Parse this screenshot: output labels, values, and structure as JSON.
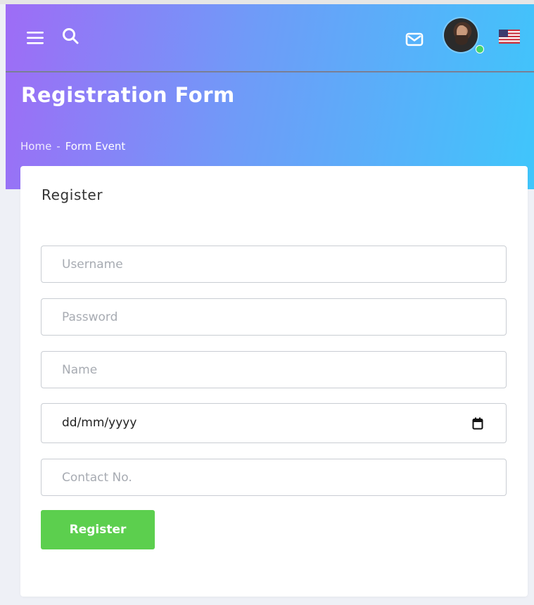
{
  "header": {
    "title": "Registration Form",
    "breadcrumb": {
      "home": "Home",
      "separator": "-",
      "current": "Form Event"
    },
    "icons": [
      "menu-icon",
      "search-icon",
      "mail-icon",
      "avatar",
      "us-flag-icon"
    ],
    "colors": {
      "gradient_start": "#9e6cf6",
      "gradient_end": "#3fc6fb",
      "online_status": "#45d46c"
    }
  },
  "card": {
    "title": "Register",
    "fields": {
      "username": {
        "placeholder": "Username",
        "value": ""
      },
      "password": {
        "placeholder": "Password",
        "value": ""
      },
      "name": {
        "placeholder": "Name",
        "value": ""
      },
      "date": {
        "display": "dd/mm/yyyy"
      },
      "contact": {
        "placeholder": "Contact No.",
        "value": ""
      }
    },
    "submit_label": "Register",
    "submit_color": "#5ccf4e"
  }
}
